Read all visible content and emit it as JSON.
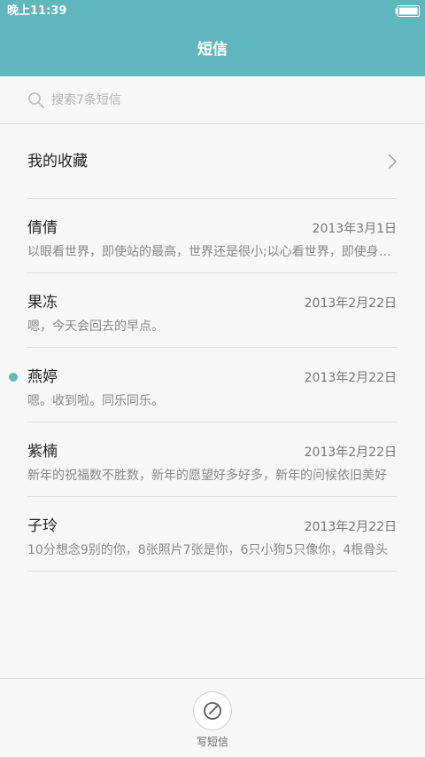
{
  "status_bar": {
    "time": "晚上11:39"
  },
  "header": {
    "title": "短信"
  },
  "search": {
    "placeholder": "搜索7条短信"
  },
  "favorites": {
    "label": "我的收藏"
  },
  "messages": [
    {
      "name": "倩倩",
      "date": "2013年3月1日",
      "preview": "以眼看世界，即使站的最高，世界还是很小;以心看世界，即使身处最低，世界也依然很大",
      "unread": false
    },
    {
      "name": "果冻",
      "date": "2013年2月22日",
      "preview": "嗯，今天会回去的早点。",
      "unread": false
    },
    {
      "name": "燕婷",
      "date": "2013年2月22日",
      "preview": "嗯。收到啦。同乐同乐。",
      "unread": true
    },
    {
      "name": "紫楠",
      "date": "2013年2月22日",
      "preview": "新年的祝福数不胜数，新年的愿望好多好多，新年的问候依旧美好",
      "unread": false
    },
    {
      "name": "子玲",
      "date": "2013年2月22日",
      "preview": "10分想念9别的你，8张照片7张是你，6只小狗5只像你，4根骨头",
      "unread": false
    }
  ],
  "bottom": {
    "compose_label": "写短信"
  },
  "colors": {
    "accent": "#5fb7bd",
    "background": "#f7f7f7",
    "divider": "#dcdcdc"
  },
  "icons": {
    "search": "search-icon",
    "chevron": "chevron-right-icon",
    "compose": "compose-icon",
    "battery": "battery-icon"
  }
}
